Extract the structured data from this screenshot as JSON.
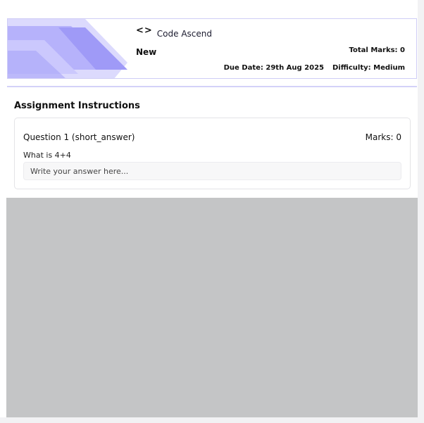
{
  "header": {
    "course_name": "Code Ascend",
    "assignment_title": "New",
    "total_marks": "Total Marks: 0",
    "due_date": "Due Date: 29th Aug 2025",
    "difficulty": "Difficulty: Medium",
    "course_icon": "code-brackets-icon",
    "code_icon_glyph": "<>"
  },
  "section": {
    "title": "Assignment Instructions"
  },
  "questions": [
    {
      "label": "Question 1 (short_answer)",
      "marks": "Marks: 0",
      "text": "What is 4+4",
      "placeholder": "Write your answer here..."
    }
  ],
  "colors": {
    "accent": "#8b87f5",
    "accent_light": "#c9c6fb",
    "border": "#cfcdf6",
    "overlay_gray": "#c4c5c6"
  }
}
